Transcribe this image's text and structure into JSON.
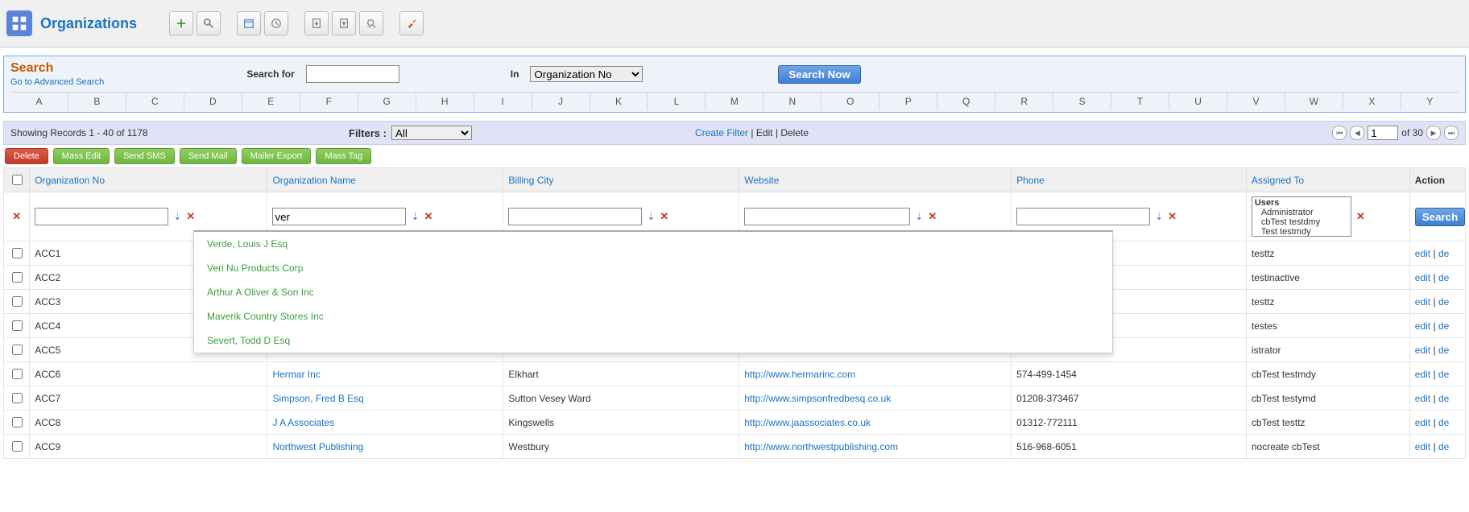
{
  "header": {
    "title": "Organizations",
    "tool_groups": [
      [
        "add-icon",
        "search-lens-icon"
      ],
      [
        "calendar-icon",
        "clock-icon"
      ],
      [
        "import-icon",
        "export-icon",
        "find-dup-icon"
      ],
      [
        "hammer-icon"
      ]
    ]
  },
  "search": {
    "title": "Search",
    "advanced_link": "Go to Advanced Search",
    "for_label": "Search for",
    "for_value": "",
    "in_label": "In",
    "in_options": [
      "Organization No"
    ],
    "in_selected": "Organization No",
    "submit": "Search Now",
    "alpha": [
      "A",
      "B",
      "C",
      "D",
      "E",
      "F",
      "G",
      "H",
      "I",
      "J",
      "K",
      "L",
      "M",
      "N",
      "O",
      "P",
      "Q",
      "R",
      "S",
      "T",
      "U",
      "V",
      "W",
      "X",
      "Y"
    ]
  },
  "list_info": {
    "showing": "Showing Records 1 - 40 of 1178",
    "filters_label": "Filters :",
    "filters_options": [
      "All"
    ],
    "filters_selected": "All",
    "create_filter": "Create Filter",
    "edit": "Edit",
    "delete": "Delete",
    "page_current": "1",
    "page_total": "of 30"
  },
  "mass_actions": {
    "delete": "Delete",
    "mass_edit": "Mass Edit",
    "send_sms": "Send SMS",
    "send_mail": "Send Mail",
    "mailer_export": "Mailer Export",
    "mass_tag": "Mass Tag"
  },
  "columns": {
    "org_no": "Organization No",
    "org_name": "Organization Name",
    "billing_city": "Billing City",
    "website": "Website",
    "phone": "Phone",
    "assigned": "Assigned To",
    "action": "Action"
  },
  "col_filters": {
    "org_no": "",
    "org_name": "ver",
    "billing_city": "",
    "website": "",
    "phone": "",
    "assigned_group": "Users",
    "assigned_opts": [
      "Administrator",
      "cbTest testdmy",
      "Test testmdy"
    ],
    "search_btn": "Search"
  },
  "autocomplete": [
    "Verde, Louis J Esq",
    "Veri Nu Products Corp",
    "Arthur A Oliver & Son Inc",
    "Maverik Country Stores Inc",
    "Severt, Todd D Esq"
  ],
  "rows": [
    {
      "no": "ACC1",
      "name": "",
      "city": "",
      "web": "",
      "phone": "",
      "assigned": "testtz"
    },
    {
      "no": "ACC2",
      "name": "",
      "city": "",
      "web": "",
      "phone": "",
      "assigned": "testinactive"
    },
    {
      "no": "ACC3",
      "name": "",
      "city": "",
      "web": "",
      "phone": "",
      "assigned": "testtz"
    },
    {
      "no": "ACC4",
      "name": "",
      "city": "",
      "web": "",
      "phone": "",
      "assigned": "testes"
    },
    {
      "no": "ACC5",
      "name": "",
      "city": "",
      "web": "",
      "phone": "",
      "assigned": "istrator"
    },
    {
      "no": "ACC6",
      "name": "Hermar Inc",
      "city": "Elkhart",
      "web": "http://www.hermarinc.com",
      "phone": "574-499-1454",
      "assigned": "cbTest testmdy"
    },
    {
      "no": "ACC7",
      "name": "Simpson, Fred B Esq",
      "city": "Sutton Vesey Ward",
      "web": "http://www.simpsonfredbesq.co.uk",
      "phone": "01208-373467",
      "assigned": "cbTest testymd"
    },
    {
      "no": "ACC8",
      "name": "J A Associates",
      "city": "Kingswells",
      "web": "http://www.jaassociates.co.uk",
      "phone": "01312-772111",
      "assigned": "cbTest testtz"
    },
    {
      "no": "ACC9",
      "name": "Northwest Publishing",
      "city": "Westbury",
      "web": "http://www.northwestpublishing.com",
      "phone": "516-968-6051",
      "assigned": "nocreate cbTest"
    }
  ],
  "row_action": {
    "edit": "edit",
    "sep": " | ",
    "del": "de"
  }
}
